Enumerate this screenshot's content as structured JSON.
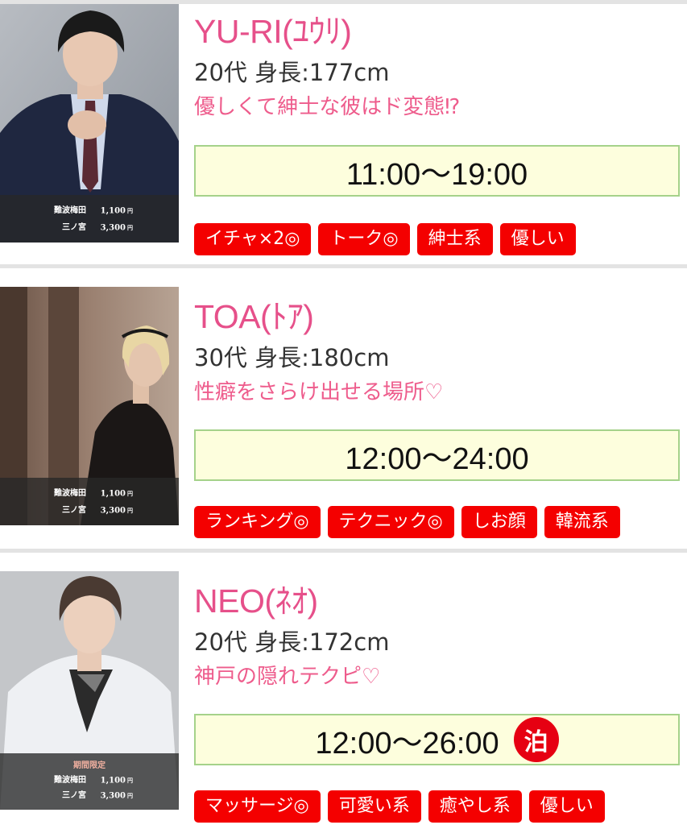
{
  "casts": [
    {
      "name": "YU-RI(ﾕｳﾘ)",
      "age": "20代",
      "height": "身長:177cm",
      "catchphrase": "優しくて紳士な彼はド変態⁉",
      "hours": "11:00〜19:00",
      "stay_badge": "",
      "tags": [
        "イチャ×2◎",
        "トーク◎",
        "紳士系",
        "優しい"
      ],
      "price_label": "",
      "prices": [
        {
          "area": "難波梅田",
          "amount": "1,100",
          "unit": "円"
        },
        {
          "area": "三ノ宮",
          "amount": "3,300",
          "unit": "円"
        }
      ]
    },
    {
      "name": "TOA(ﾄｱ)",
      "age": "30代",
      "height": "身長:180cm",
      "catchphrase": "性癖をさらけ出せる場所♡",
      "hours": "12:00〜24:00",
      "stay_badge": "",
      "tags": [
        "ランキング◎",
        "テクニック◎",
        "しお顔",
        "韓流系"
      ],
      "price_label": "",
      "prices": [
        {
          "area": "難波梅田",
          "amount": "1,100",
          "unit": "円"
        },
        {
          "area": "三ノ宮",
          "amount": "3,300",
          "unit": "円"
        }
      ]
    },
    {
      "name": "NEO(ﾈｵ)",
      "age": "20代",
      "height": "身長:172cm",
      "catchphrase": "神戸の隠れテクピ♡",
      "hours": "12:00〜26:00",
      "stay_badge": "泊",
      "tags": [
        "マッサージ◎",
        "可愛い系",
        "癒やし系",
        "優しい"
      ],
      "price_label": "期間限定",
      "prices": [
        {
          "area": "難波梅田",
          "amount": "1,100",
          "unit": "円"
        },
        {
          "area": "三ノ宮",
          "amount": "3,300",
          "unit": "円"
        }
      ]
    }
  ],
  "colors": {
    "name": "#e6508a",
    "catchphrase": "#ee5c8c",
    "tag_bg": "#f40000",
    "hours_bg": "#fdfedd",
    "hours_border": "#a5d28a",
    "stay_badge_bg": "#e60012"
  }
}
